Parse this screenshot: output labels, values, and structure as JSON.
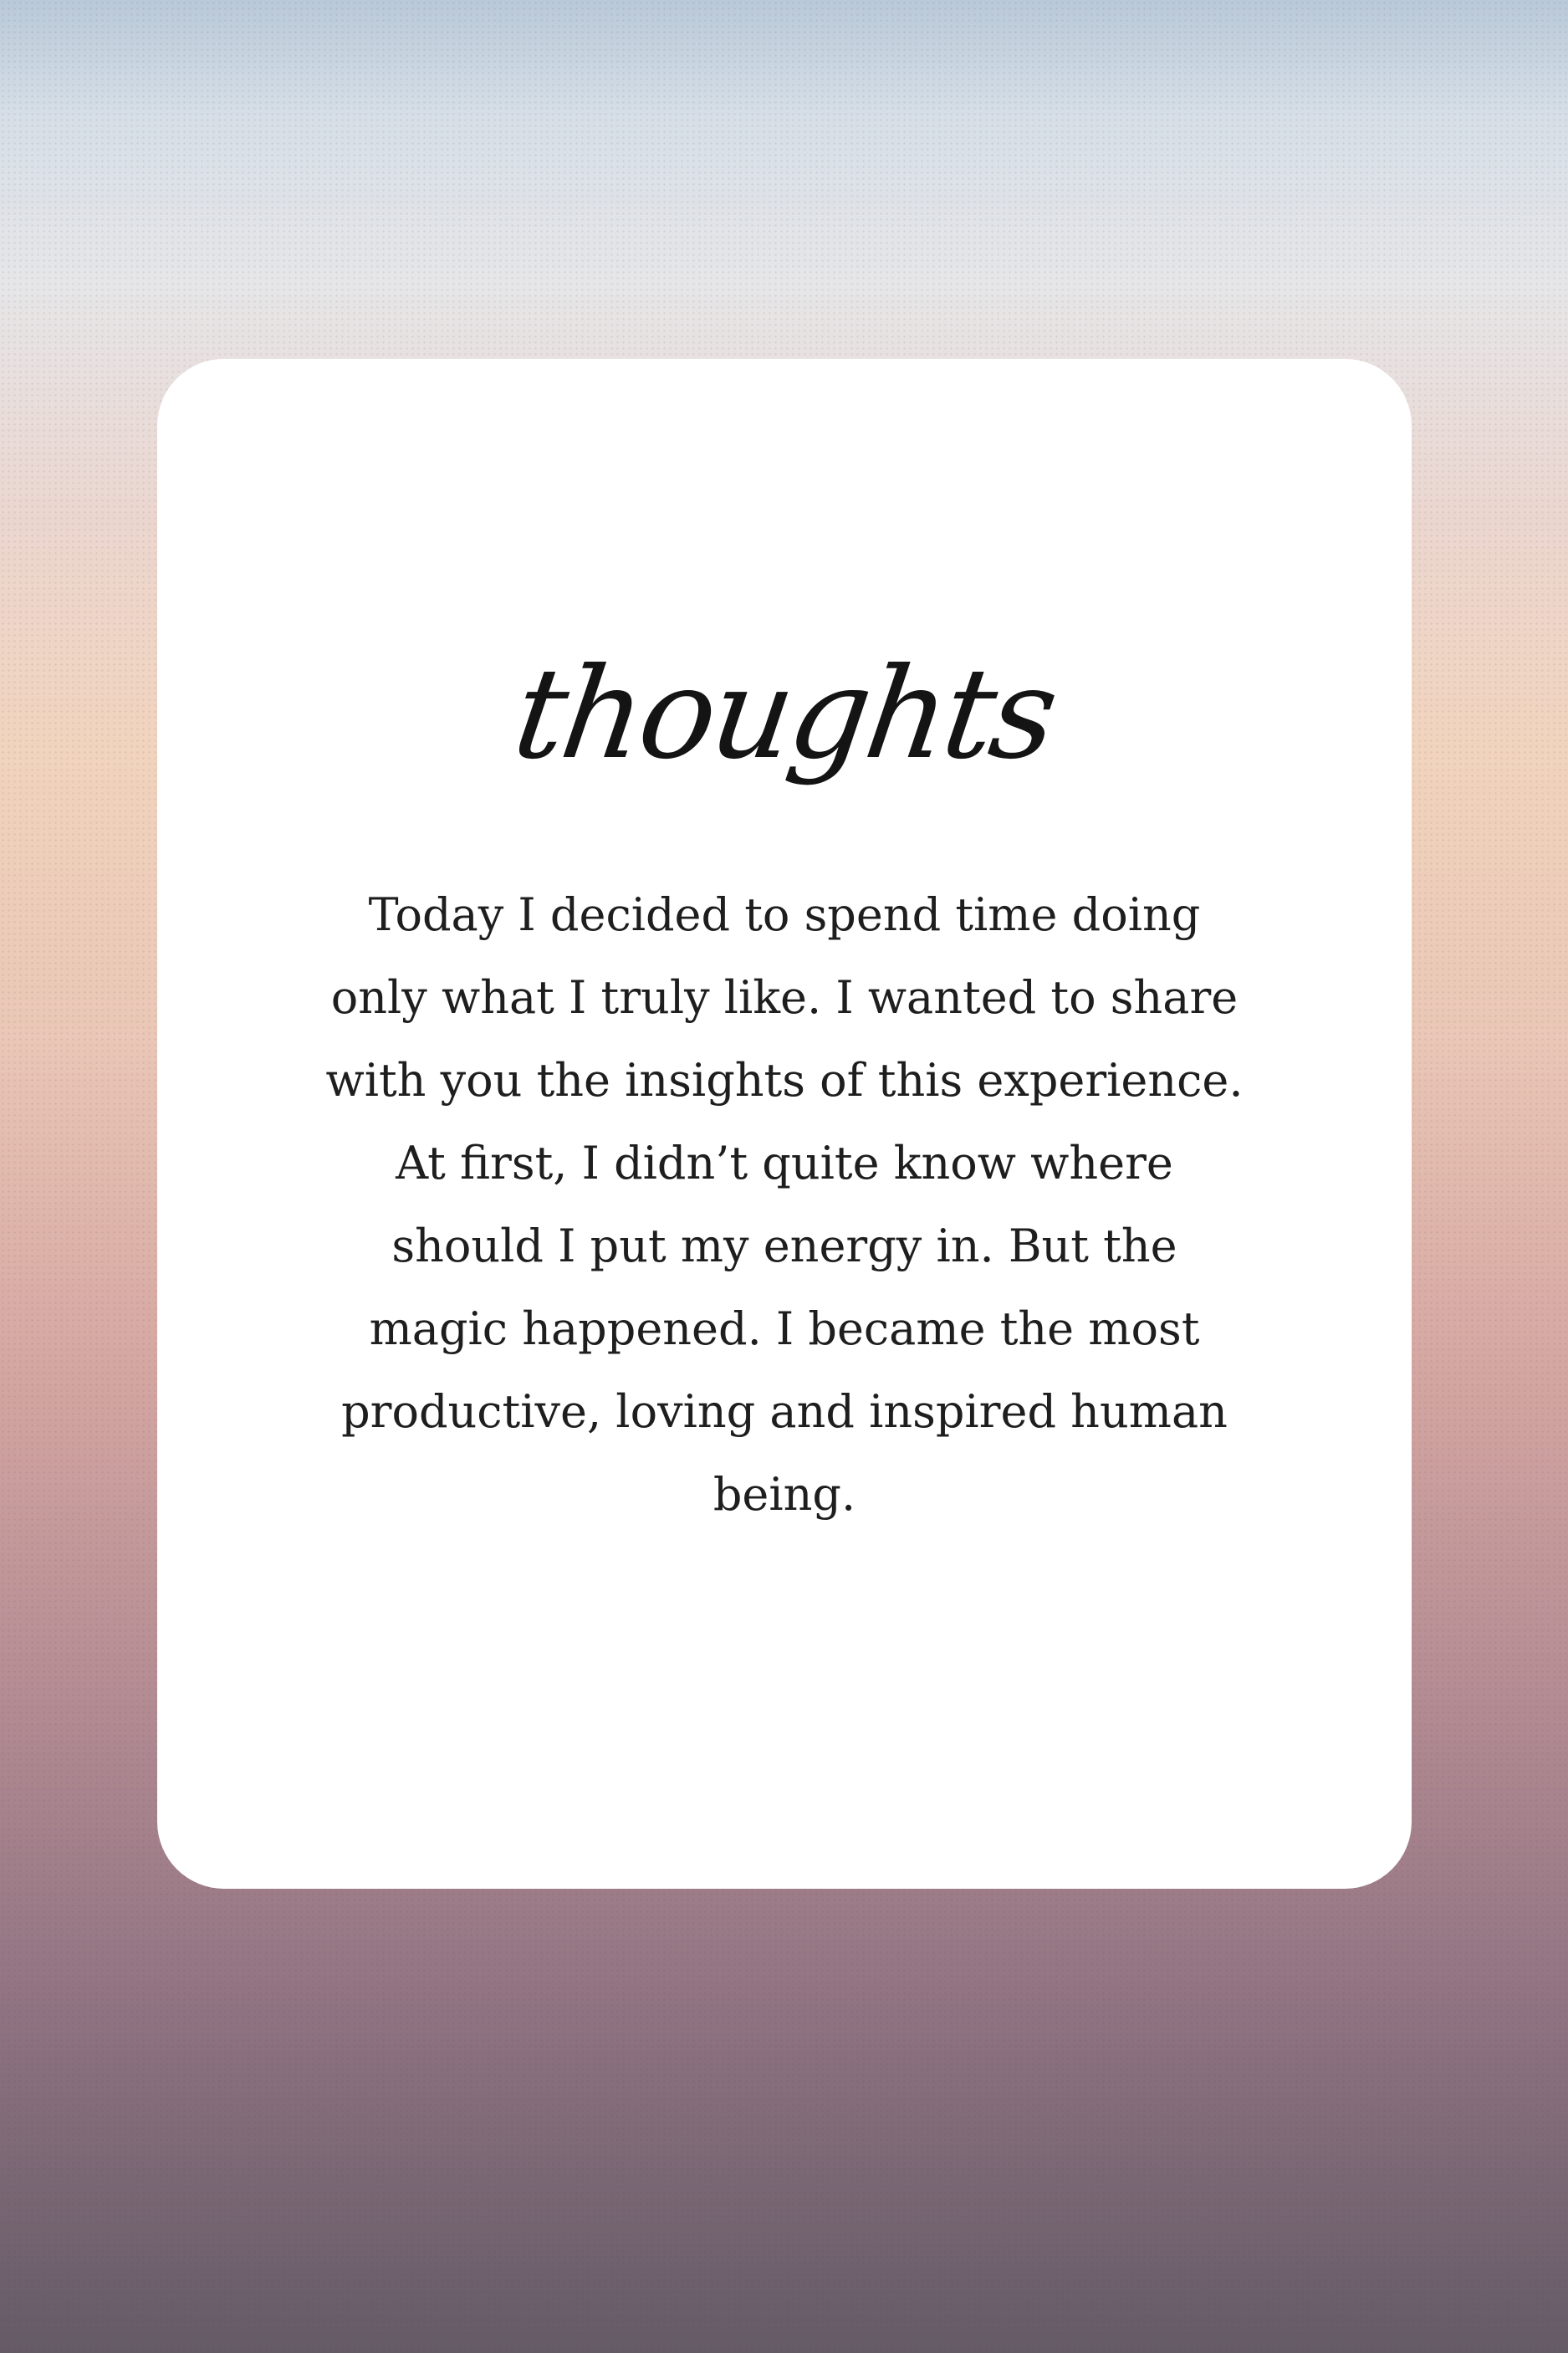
{
  "card": {
    "heading": "thoughts",
    "body": "Today I decided to spend time doing only what I truly like. I wanted to share with you the insights of this experience. At first, I didn’t quite know where should I put my energy in. But the magic happened. I became the most productive, loving and inspired human being."
  },
  "colors": {
    "background_top": "#b9c9d9",
    "background_middle": "#f1d4bd",
    "background_bottom": "#645b66",
    "card": "#ffffff",
    "text": "#1e1e1e"
  }
}
